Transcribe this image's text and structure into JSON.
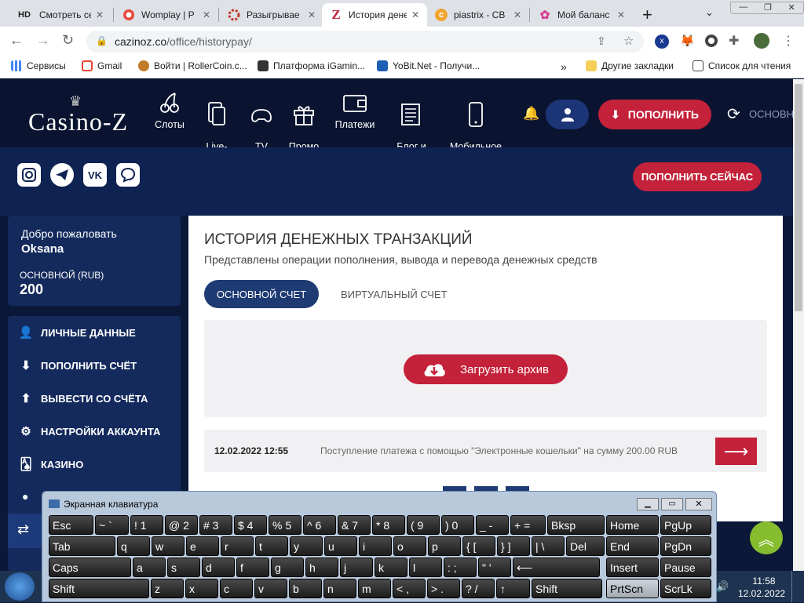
{
  "browser": {
    "tabs": [
      {
        "favicon": "HD",
        "title": "Смотреть се",
        "active": false
      },
      {
        "favicon": "womplay-icon",
        "title": "Womplay | P",
        "active": false
      },
      {
        "favicon": "gear-icon",
        "title": "Разыгрывае",
        "active": false
      },
      {
        "favicon": "Z",
        "title": "История дене",
        "active": true
      },
      {
        "favicon": "c",
        "title": "piastrix - CB",
        "active": false
      },
      {
        "favicon": "flower-icon",
        "title": "Мой баланс",
        "active": false
      }
    ],
    "new_tab": "+",
    "url_host": "cazinoz.co",
    "url_path": "/office/historypay/",
    "bookmarks": [
      {
        "icon": "apps-icon",
        "label": "Сервисы"
      },
      {
        "icon": "gmail-icon",
        "label": "Gmail"
      },
      {
        "icon": "owl-icon",
        "label": "Войти | RollerCoin.c..."
      },
      {
        "icon": "ship-icon",
        "label": "Платформа iGamin..."
      },
      {
        "icon": "yobit-icon",
        "label": "YoBit.Net - Получи..."
      }
    ],
    "bookmarks_more": "»",
    "other_bookmarks": "Другие закладки",
    "reading_list": "Список для чтения"
  },
  "site": {
    "logo": "Casino-Z",
    "nav": [
      {
        "icon": "cherries-icon",
        "label": "Слоты"
      },
      {
        "icon": "live-casino-icon",
        "label": "Live-\nКазино"
      },
      {
        "icon": "gamepad-icon",
        "label": "TV\nИгры"
      },
      {
        "icon": "gift-icon",
        "label": "Промо\nакции"
      },
      {
        "icon": "wallet-icon",
        "label": "Платежи"
      },
      {
        "icon": "newspaper-icon",
        "label": "Блог и\nНовости"
      },
      {
        "icon": "mobile-icon",
        "label": "Мобильное\nприложение"
      }
    ],
    "deposit_button": "ПОПОЛНИТЬ",
    "account_type": "ОСНОВНО",
    "deposit_now_button": "ПОПОЛНИТЬ СЕЙЧАС",
    "social": [
      "instagram-icon",
      "telegram-icon",
      "vk-icon",
      "chat-icon"
    ]
  },
  "sidebar": {
    "welcome": "Добро пожаловать",
    "username": "Oksana",
    "balance_label": "ОСНОВНОЙ (RUB)",
    "balance": "200",
    "menu": [
      {
        "icon": "user-plus-icon",
        "label": "ЛИЧНЫЕ ДАННЫЕ"
      },
      {
        "icon": "download-icon",
        "label": "ПОПОЛНИТЬ СЧЁТ"
      },
      {
        "icon": "upload-icon",
        "label": "ВЫВЕСТИ СО СЧЁТА"
      },
      {
        "icon": "settings-icon",
        "label": "НАСТРОЙКИ АККАУНТА"
      },
      {
        "icon": "cards-icon",
        "label": "КАЗИНО"
      }
    ]
  },
  "main": {
    "title": "ИСТОРИЯ ДЕНЕЖНЫХ ТРАНЗАКЦИЙ",
    "subtitle": "Представлены операции пополнения, вывода и перевода денежных средств",
    "tabs": [
      {
        "label": "ОСНОВНОЙ СЧЕТ",
        "active": true
      },
      {
        "label": "ВИРТУАЛЬНЫЙ СЧЕТ",
        "active": false
      }
    ],
    "archive_button": "Загрузить архив",
    "transactions": [
      {
        "datetime": "12.02.2022 12:55",
        "description": "Поступление платежа с помощью \"Электронные кошельки\" на сумму 200.00 RUB"
      }
    ]
  },
  "keyboard": {
    "title": "Экранная клавиатура",
    "rows": [
      [
        [
          "Esc",
          ""
        ],
        [
          "~ `",
          ""
        ],
        [
          "! 1",
          ""
        ],
        [
          "@ 2",
          ""
        ],
        [
          "# 3",
          ""
        ],
        [
          "$ 4",
          ""
        ],
        [
          "% 5",
          ""
        ],
        [
          "^ 6",
          ""
        ],
        [
          "& 7",
          ""
        ],
        [
          "* 8",
          ""
        ],
        [
          "( 9",
          ""
        ],
        [
          ") 0",
          ""
        ],
        [
          "_ -",
          ""
        ],
        [
          "+ =",
          ""
        ],
        [
          "Bksp",
          ""
        ],
        [
          "Home",
          ""
        ],
        [
          "PgUp",
          ""
        ]
      ],
      [
        [
          "Tab",
          ""
        ],
        [
          "q",
          ""
        ],
        [
          "w",
          ""
        ],
        [
          "e",
          ""
        ],
        [
          "r",
          ""
        ],
        [
          "t",
          ""
        ],
        [
          "y",
          ""
        ],
        [
          "u",
          ""
        ],
        [
          "i",
          ""
        ],
        [
          "o",
          ""
        ],
        [
          "p",
          ""
        ],
        [
          "{ [",
          ""
        ],
        [
          "} ]",
          ""
        ],
        [
          "| \\",
          ""
        ],
        [
          "Del",
          ""
        ],
        [
          "End",
          ""
        ],
        [
          "PgDn",
          ""
        ]
      ],
      [
        [
          "Caps",
          ""
        ],
        [
          "a",
          ""
        ],
        [
          "s",
          ""
        ],
        [
          "d",
          ""
        ],
        [
          "f",
          ""
        ],
        [
          "g",
          ""
        ],
        [
          "h",
          ""
        ],
        [
          "j",
          ""
        ],
        [
          "k",
          ""
        ],
        [
          "l",
          ""
        ],
        [
          ": ;",
          ""
        ],
        [
          "\" '",
          ""
        ],
        [
          "⟵",
          ""
        ],
        [
          "Insert",
          ""
        ],
        [
          "Pause",
          ""
        ]
      ],
      [
        [
          "Shift",
          ""
        ],
        [
          "z",
          ""
        ],
        [
          "x",
          ""
        ],
        [
          "c",
          ""
        ],
        [
          "v",
          ""
        ],
        [
          "b",
          ""
        ],
        [
          "n",
          ""
        ],
        [
          "m",
          ""
        ],
        [
          "< ,",
          ""
        ],
        [
          "> .",
          ""
        ],
        [
          "? /",
          ""
        ],
        [
          "↑",
          ""
        ],
        [
          "Shift",
          ""
        ],
        [
          "PrtScn",
          ""
        ],
        [
          "ScrLk",
          ""
        ]
      ]
    ]
  },
  "taskbar": {
    "time": "11:58",
    "date": "12.02.2022"
  }
}
